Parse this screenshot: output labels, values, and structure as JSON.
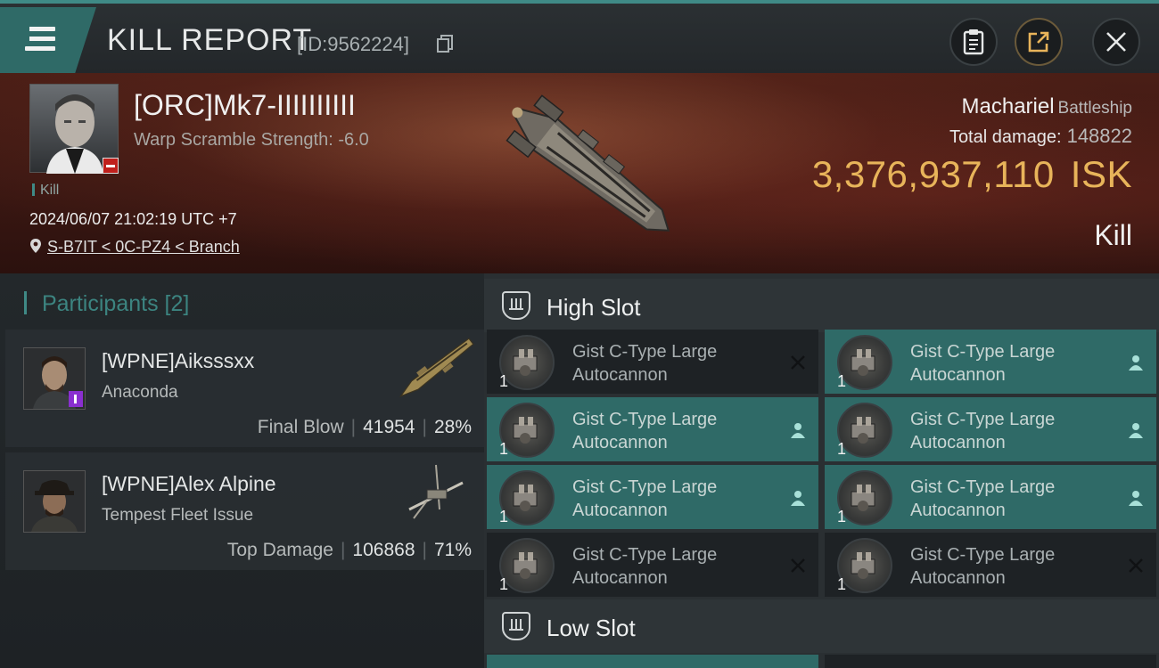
{
  "header": {
    "title": "KILL REPORT",
    "report_id": "[ID:9562224]"
  },
  "victim": {
    "name": "[ORC]Mk7-IIIIIIIIII",
    "scramble": "Warp Scramble Strength: -6.0",
    "tag": "Kill",
    "datetime": "2024/06/07 21:02:19 UTC +7",
    "location": "S-B7IT < 0C-PZ4 < Branch",
    "ship": "Machariel",
    "ship_class": "Battleship",
    "total_damage_label": "Total damage:",
    "total_damage": "148822",
    "isk_value": "3,376,937,110",
    "isk_unit": "ISK",
    "result": "Kill"
  },
  "participants": {
    "label": "Participants",
    "count": "[2]",
    "rows": [
      {
        "name": "[WPNE]Aiksssxx",
        "ship": "Anaconda",
        "role": "Final Blow",
        "damage": "41954",
        "percent": "28%"
      },
      {
        "name": "[WPNE]Alex Alpine",
        "ship": "Tempest Fleet Issue",
        "role": "Top Damage",
        "damage": "106868",
        "percent": "71%"
      }
    ]
  },
  "fitting": {
    "high_slot_label": "High Slot",
    "low_slot_label": "Low Slot",
    "modules": [
      {
        "line1": "Gist C-Type Large",
        "line2": "Autocannon",
        "qty": "1",
        "status": "destroyed"
      },
      {
        "line1": "Gist C-Type Large",
        "line2": "Autocannon",
        "qty": "1",
        "status": "dropped"
      },
      {
        "line1": "Gist C-Type Large",
        "line2": "Autocannon",
        "qty": "1",
        "status": "dropped"
      },
      {
        "line1": "Gist C-Type Large",
        "line2": "Autocannon",
        "qty": "1",
        "status": "dropped"
      },
      {
        "line1": "Gist C-Type Large",
        "line2": "Autocannon",
        "qty": "1",
        "status": "dropped"
      },
      {
        "line1": "Gist C-Type Large",
        "line2": "Autocannon",
        "qty": "1",
        "status": "dropped"
      },
      {
        "line1": "Gist C-Type Large",
        "line2": "Autocannon",
        "qty": "1",
        "status": "destroyed"
      },
      {
        "line1": "Gist C-Type Large",
        "line2": "Autocannon",
        "qty": "1",
        "status": "destroyed"
      }
    ]
  },
  "icons": {
    "menu": "hamburger-icon",
    "copy": "copy-icon",
    "clipboard": "clipboard-icon",
    "share": "share-icon",
    "close": "close-icon",
    "location": "location-pin-icon",
    "slot": "shield-slot-icon",
    "destroyed": "x-icon",
    "dropped": "person-icon"
  },
  "colors": {
    "accent": "#3f8a86",
    "isk": "#e8b45a",
    "highlight_row": "#2f6a67",
    "danger": "#c0201c"
  }
}
